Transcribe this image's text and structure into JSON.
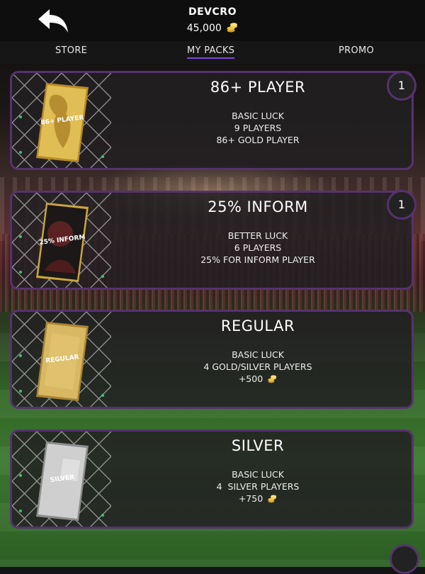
{
  "header": {
    "username": "DEVCRO",
    "coins": "45,000",
    "back_icon": "back-arrow-icon",
    "coin_icon": "coin-stack-icon",
    "accent_color": "#56326e"
  },
  "tabs": [
    {
      "label": "STORE",
      "active": false
    },
    {
      "label": "MY PACKS",
      "active": true
    },
    {
      "label": "PROMO",
      "active": false
    }
  ],
  "packs": [
    {
      "title": "86+ PLAYER",
      "card_label": "86+ PLAYER",
      "line1": "BASIC LUCK",
      "line2": "9 PLAYERS",
      "line3": "86+ GOLD PLAYER",
      "count": "1",
      "card_color": "#c9a53c"
    },
    {
      "title": "25% INFORM",
      "card_label": "25% INFORM",
      "line1": "BETTER LUCK",
      "line2": "6 PLAYERS",
      "line3": "25% FOR INFORM PLAYER",
      "count": "1",
      "card_color": "#1e1a1a"
    },
    {
      "title": "REGULAR",
      "card_label": "REGULAR",
      "line1": "BASIC LUCK",
      "line2": "4 GOLD/SILVER PLAYERS",
      "line3": "+500",
      "card_color": "#c8a54e"
    },
    {
      "title": "SILVER",
      "card_label": "SILVER",
      "line1": "BASIC LUCK",
      "line2": "4  SILVER PLAYERS",
      "line3": "+750",
      "card_color": "#bdbdbd"
    }
  ]
}
